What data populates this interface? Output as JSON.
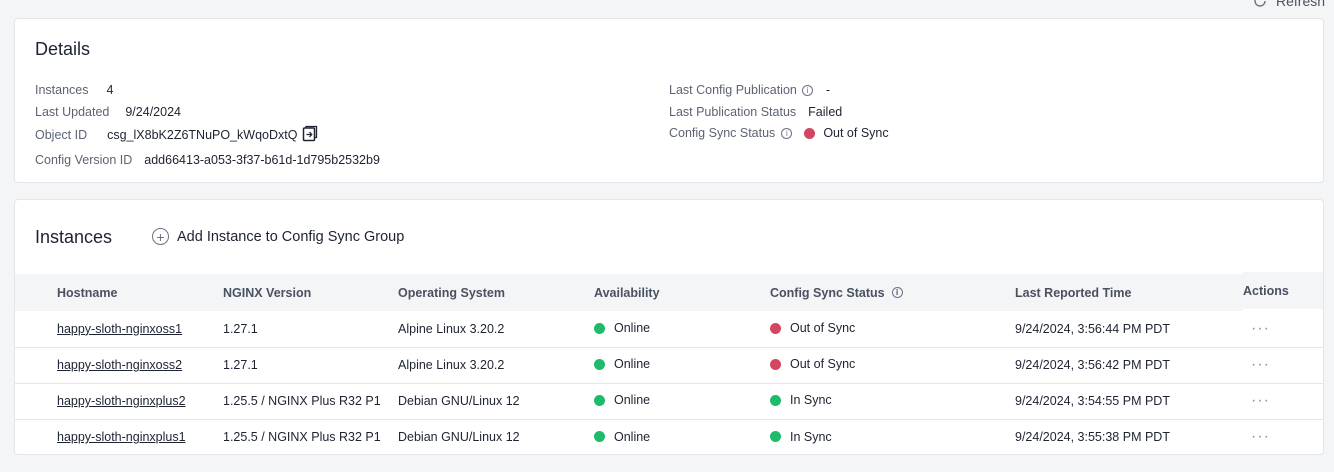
{
  "refresh": {
    "label": "Refresh"
  },
  "details": {
    "title": "Details",
    "instances_label": "Instances",
    "instances_value": "4",
    "last_updated_label": "Last Updated",
    "last_updated_value": "9/24/2024",
    "object_id_label": "Object ID",
    "object_id_value": "csg_lX8bK2Z6TNuPO_kWqoDxtQ",
    "config_version_label": "Config Version ID",
    "config_version_value": "add66413-a053-3f37-b61d-1d795b2532b9",
    "last_config_pub_label": "Last Config Publication",
    "last_config_pub_value": "-",
    "last_pub_status_label": "Last Publication Status",
    "last_pub_status_value": "Failed",
    "config_sync_label": "Config Sync Status",
    "config_sync_value": "Out of Sync",
    "config_sync_color": "#d2475f"
  },
  "instances": {
    "title": "Instances",
    "add_button": "Add Instance to Config Sync Group",
    "columns": {
      "hostname": "Hostname",
      "nginx_version": "NGINX Version",
      "os": "Operating System",
      "availability": "Availability",
      "config_sync": "Config Sync Status",
      "last_reported": "Last Reported Time",
      "actions": "Actions"
    },
    "rows": [
      {
        "hostname": "happy-sloth-nginxoss1",
        "version": "1.27.1",
        "os": "Alpine Linux 3.20.2",
        "availability": "Online",
        "sync": "Out of Sync",
        "sync_color": "red",
        "time": "9/24/2024, 3:56:44 PM PDT",
        "actions": "···"
      },
      {
        "hostname": "happy-sloth-nginxoss2",
        "version": "1.27.1",
        "os": "Alpine Linux 3.20.2",
        "availability": "Online",
        "sync": "Out of Sync",
        "sync_color": "red",
        "time": "9/24/2024, 3:56:42 PM PDT",
        "actions": "···"
      },
      {
        "hostname": "happy-sloth-nginxplus2",
        "version": "1.25.5 / NGINX Plus R32 P1",
        "os": "Debian GNU/Linux 12",
        "availability": "Online",
        "sync": "In Sync",
        "sync_color": "green",
        "time": "9/24/2024, 3:54:55 PM PDT",
        "actions": "···"
      },
      {
        "hostname": "happy-sloth-nginxplus1",
        "version": "1.25.5 / NGINX Plus R32 P1",
        "os": "Debian GNU/Linux 12",
        "availability": "Online",
        "sync": "In Sync",
        "sync_color": "green",
        "time": "9/24/2024, 3:55:38 PM PDT",
        "actions": "···"
      }
    ]
  },
  "colors": {
    "online": "#1fba6b",
    "out_of_sync": "#d2475f",
    "in_sync": "#1fba6b"
  }
}
